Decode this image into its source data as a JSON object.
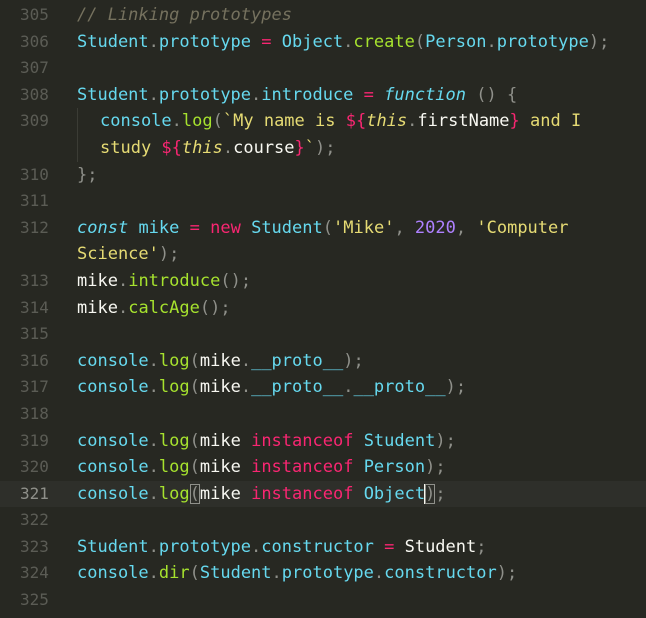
{
  "editor": {
    "colors": {
      "background": "#272822",
      "gutter_text": "#5b5c55",
      "comment": "#75715e",
      "identifier": "#66d9ef",
      "method": "#a6e22e",
      "keyword": "#f92672",
      "string": "#e6db74",
      "number": "#ae81ff"
    },
    "active_line": "321",
    "lines": [
      {
        "num": "305"
      },
      {
        "num": "306"
      },
      {
        "num": "307"
      },
      {
        "num": "308"
      },
      {
        "num": "309"
      },
      {
        "num": "310"
      },
      {
        "num": "311"
      },
      {
        "num": "312"
      },
      {
        "num": "313"
      },
      {
        "num": "314"
      },
      {
        "num": "315"
      },
      {
        "num": "316"
      },
      {
        "num": "317"
      },
      {
        "num": "318"
      },
      {
        "num": "319"
      },
      {
        "num": "320"
      },
      {
        "num": "321"
      },
      {
        "num": "322"
      },
      {
        "num": "323"
      },
      {
        "num": "324"
      },
      {
        "num": "325"
      }
    ],
    "tokens": {
      "comment_linking": "// Linking prototypes",
      "student": "Student",
      "dot": ".",
      "prototype": "prototype",
      "assign": " = ",
      "object": "Object",
      "create": "create",
      "lparen": "(",
      "rparen": ")",
      "semicolon": ";",
      "person": "Person",
      "introduce": "introduce",
      "function_kw": "function",
      "empty_parens": " () {",
      "console": "console",
      "log": "log",
      "backtick": "`",
      "my_name_is": "My name is ",
      "interp_open": "${",
      "interp_close": "}",
      "this_kw": "this",
      "firstName": "firstName",
      "and_i": " and I",
      "study": "study ",
      "course": "course",
      "close_backtick_paren": "`);",
      "close_brace_semi": "};",
      "const_kw": "const",
      "mike": "mike",
      "new_kw": "new",
      "quote": "'",
      "mike_str": "Mike",
      "comma_space": ", ",
      "year_2020": "2020",
      "computer": "Computer",
      "science": "Science",
      "calcAge": "calcAge",
      "proto": "__proto__",
      "instanceof_kw": "instanceof",
      "constructor": "constructor",
      "dir": "dir"
    }
  }
}
